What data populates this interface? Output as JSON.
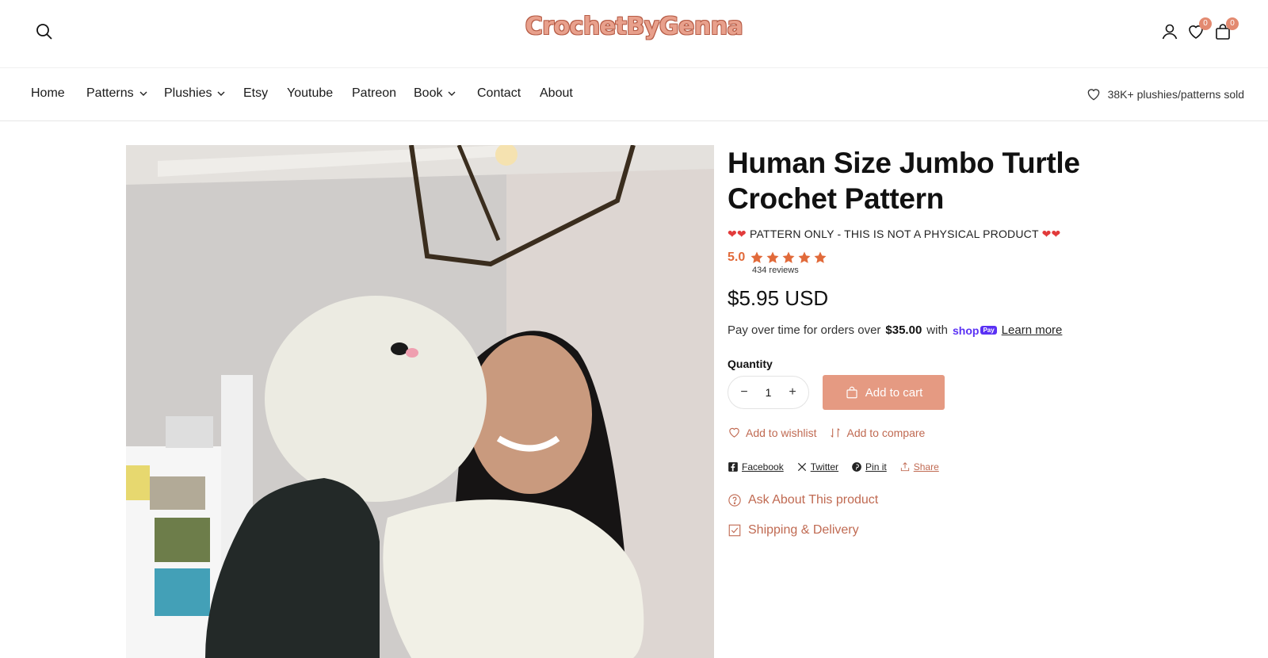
{
  "header": {
    "logo_text": "CrochetByGenna",
    "wishlist_count": "0",
    "cart_count": "0"
  },
  "nav": {
    "items": [
      {
        "label": "Home"
      },
      {
        "label": "Patterns"
      },
      {
        "label": "Plushies"
      },
      {
        "label": "Etsy"
      },
      {
        "label": "Youtube"
      },
      {
        "label": "Patreon"
      },
      {
        "label": "Book"
      },
      {
        "label": "Contact"
      },
      {
        "label": "About"
      }
    ],
    "sold_text": "38K+ plushies/patterns sold"
  },
  "product": {
    "title": "Human Size Jumbo Turtle Crochet Pattern",
    "note": "PATTERN ONLY - THIS IS NOT A PHYSICAL PRODUCT",
    "rating": "5.0",
    "reviews": "434 reviews",
    "price": "$5.95 USD",
    "pay_prefix": "Pay over time for orders over",
    "pay_amount": "$35.00",
    "pay_with": "with",
    "shop_pay": "shop",
    "shop_pay_badge": "Pay",
    "learn_more": "Learn more",
    "quantity_label": "Quantity",
    "quantity_value": "1",
    "add_to_cart": "Add to cart",
    "add_to_wishlist": "Add to wishlist",
    "add_to_compare": "Add to compare",
    "share": {
      "facebook": "Facebook",
      "twitter": "Twitter",
      "pinterest": "Pin it",
      "share": "Share"
    },
    "ask": "Ask About This product",
    "shipping": "Shipping & Delivery"
  },
  "colors": {
    "accent": "#e59a82",
    "accent_text": "#c06a52",
    "rating": "#e16a3a",
    "logo": "#e8a08c"
  }
}
